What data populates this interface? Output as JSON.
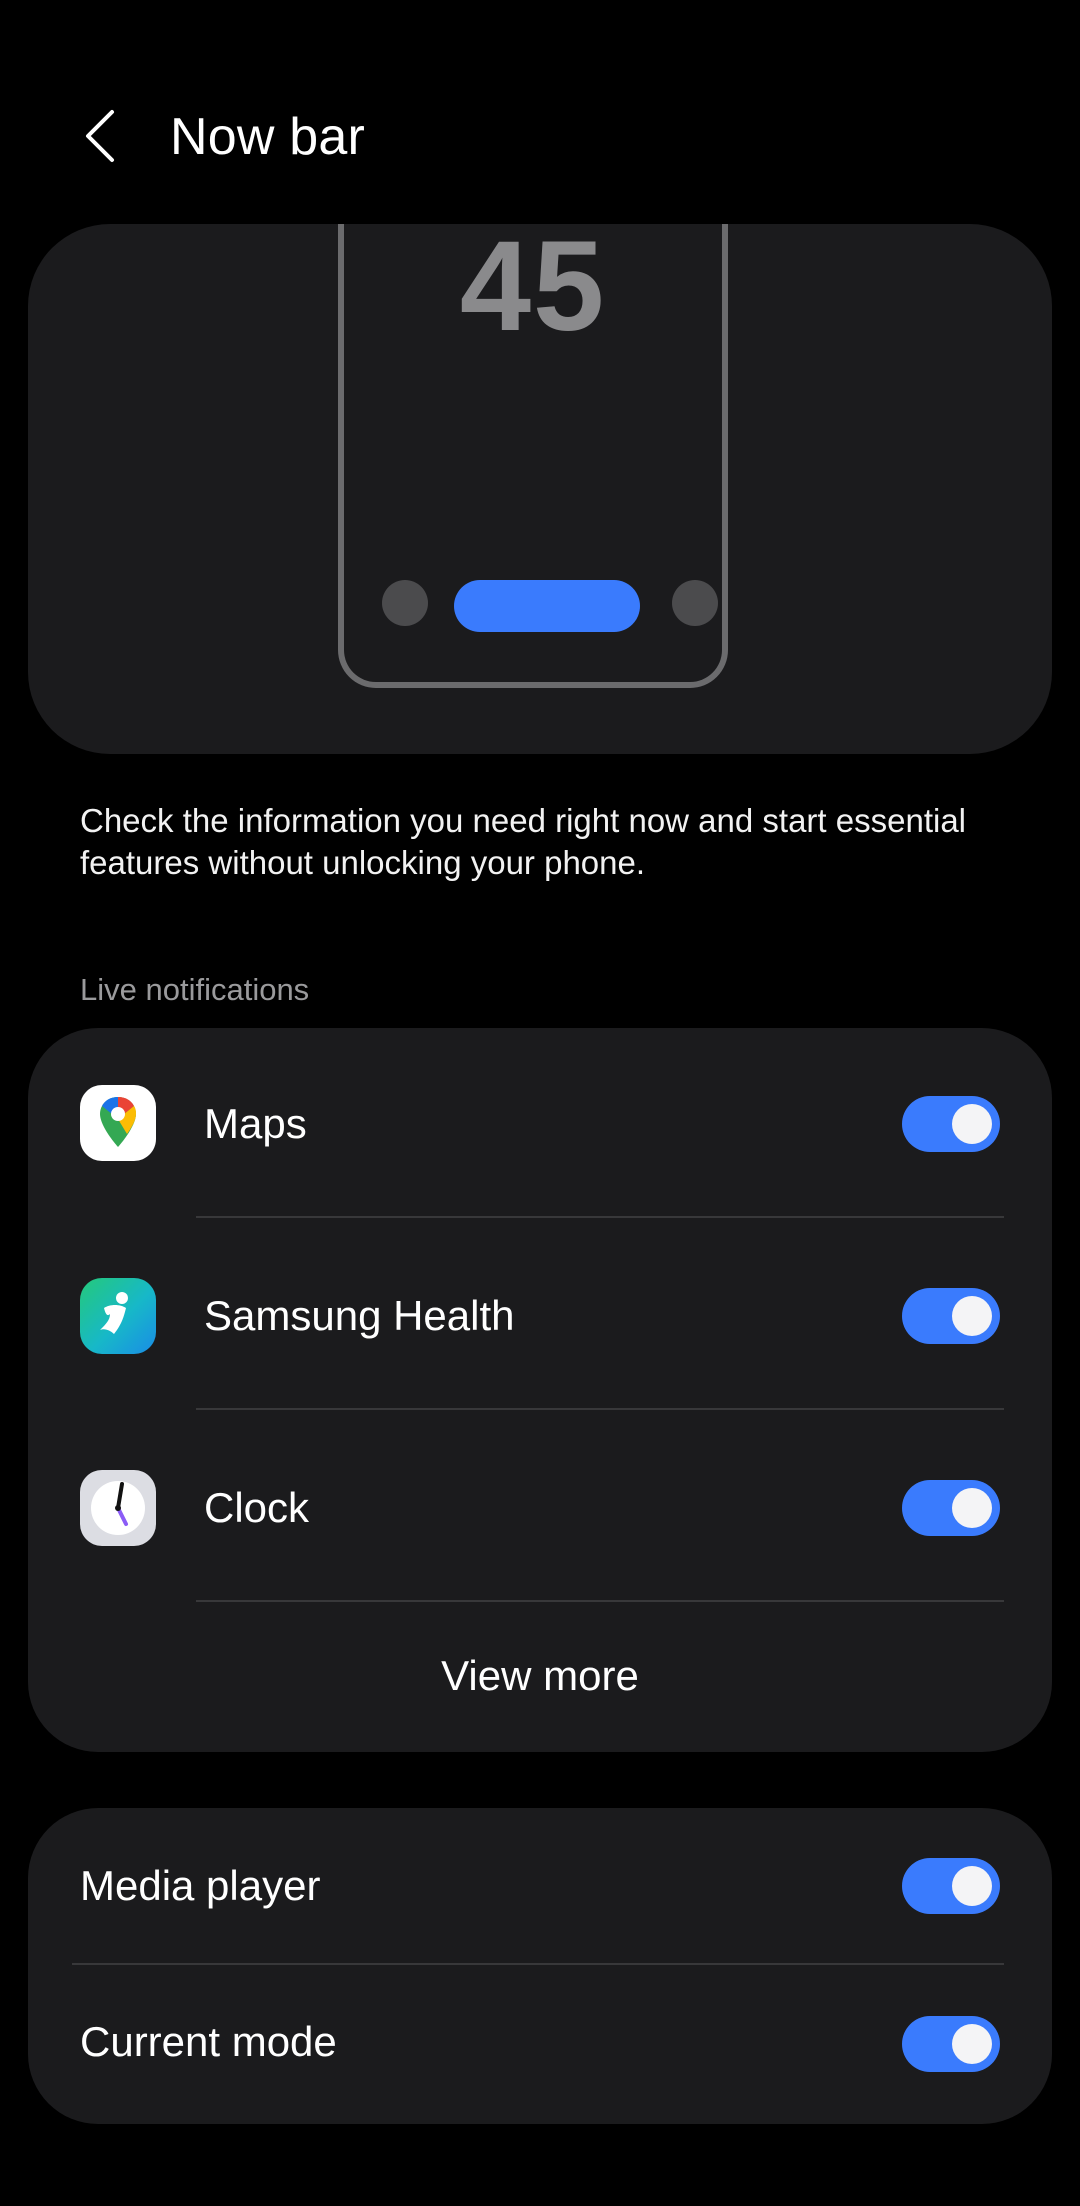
{
  "header": {
    "title": "Now bar",
    "back_icon": "chevron-left-icon"
  },
  "preview": {
    "clock_text": "45",
    "nowbar_color": "#3a7bfd"
  },
  "description": "Check the information you need right now and start essential features without unlocking your phone.",
  "live_notifications": {
    "section_label": "Live notifications",
    "items": [
      {
        "label": "Maps",
        "icon": "google-maps-icon",
        "enabled": true
      },
      {
        "label": "Samsung Health",
        "icon": "samsung-health-icon",
        "enabled": true
      },
      {
        "label": "Clock",
        "icon": "clock-app-icon",
        "enabled": true
      }
    ],
    "view_more_label": "View more"
  },
  "other_settings": {
    "items": [
      {
        "label": "Media player",
        "enabled": true
      },
      {
        "label": "Current mode",
        "enabled": true
      }
    ]
  },
  "colors": {
    "background": "#000000",
    "card": "#1b1b1d",
    "accent": "#3a7bfd",
    "divider": "#38383a",
    "muted_text": "#9a9a9c"
  }
}
